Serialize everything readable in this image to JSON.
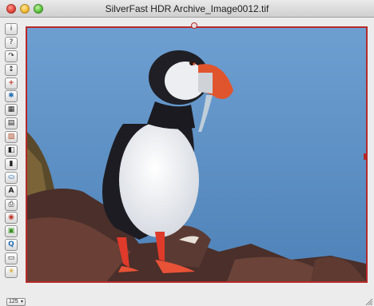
{
  "window": {
    "title": "SilverFast HDR Archive_Image0012.tif"
  },
  "toolbar": {
    "tools": [
      {
        "name": "info-tool",
        "glyph": "i"
      },
      {
        "name": "help-tool",
        "glyph": "?"
      },
      {
        "name": "rotate-tool",
        "glyph": "↷"
      },
      {
        "name": "flip-tool",
        "glyph": "↕"
      },
      {
        "name": "crosshair-tool",
        "glyph": "+"
      },
      {
        "name": "color-correction-tool",
        "glyph": "✱"
      },
      {
        "name": "histogram-tool",
        "glyph": "▦"
      },
      {
        "name": "gradation-tool",
        "glyph": "▤"
      },
      {
        "name": "selective-color-tool",
        "glyph": "▧"
      },
      {
        "name": "color-balance-tool",
        "glyph": "◧"
      },
      {
        "name": "levels-tool",
        "glyph": "▮"
      },
      {
        "name": "stamp-tool",
        "glyph": "⛀"
      },
      {
        "name": "sharpen-tool",
        "glyph": "A"
      },
      {
        "name": "print-tool",
        "glyph": "⎙"
      },
      {
        "name": "eye-tool",
        "glyph": "◉"
      },
      {
        "name": "image-tool",
        "glyph": "▣"
      },
      {
        "name": "zoom-tool",
        "glyph": "Q"
      },
      {
        "name": "save-tool",
        "glyph": "▭"
      },
      {
        "name": "tip-tool",
        "glyph": "☀"
      }
    ]
  },
  "zoom": {
    "value": "125"
  },
  "colors": {
    "frame": "#b52a2a",
    "sky": "#5d8fc3"
  }
}
